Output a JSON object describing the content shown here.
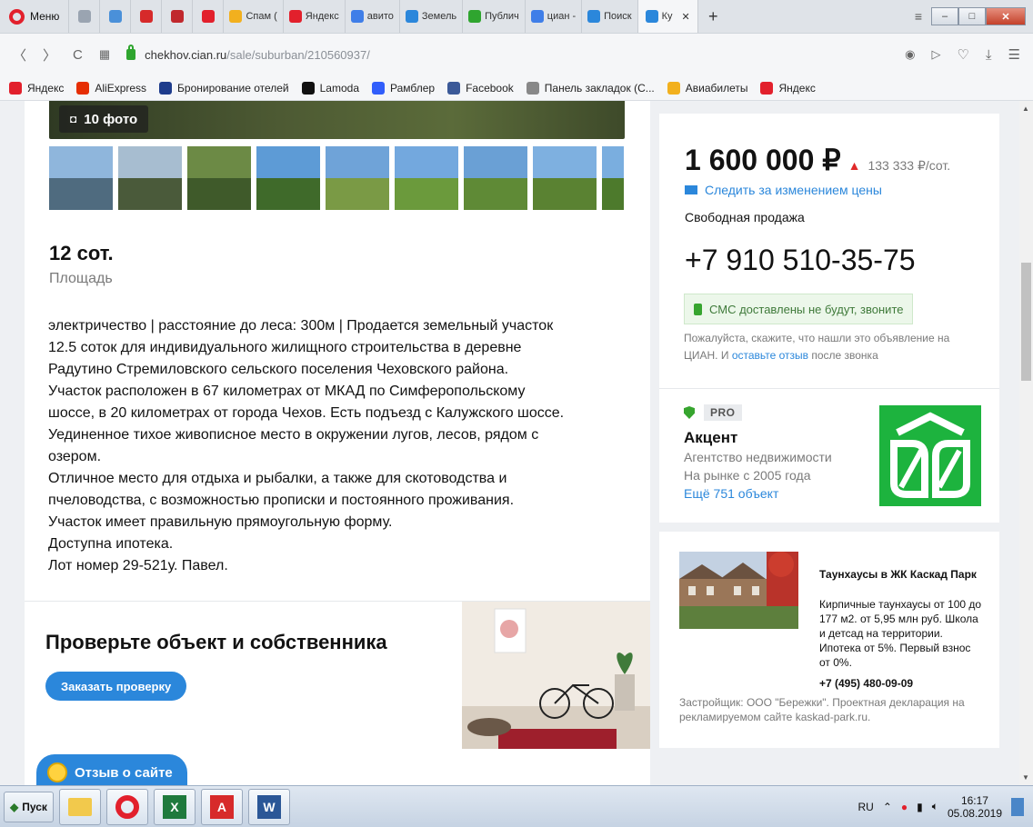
{
  "browser": {
    "menu_label": "Меню",
    "tabs": [
      {
        "label": "",
        "color": "#9aa4b1"
      },
      {
        "label": "",
        "color": "#4a90d9"
      },
      {
        "label": "",
        "color": "#d62a2a"
      },
      {
        "label": "",
        "color": "#c0282d"
      },
      {
        "label": "",
        "color": "#e2202c"
      },
      {
        "label": "Спам (",
        "color": "#f2b01e"
      },
      {
        "label": "Яндекс",
        "color": "#e2202c"
      },
      {
        "label": "авито",
        "color": "#3f7ee8"
      },
      {
        "label": "Земель",
        "color": "#2b87db"
      },
      {
        "label": "Публич",
        "color": "#2fa52f"
      },
      {
        "label": "циан -",
        "color": "#3f7ee8"
      },
      {
        "label": "Поиск",
        "color": "#2b87db"
      },
      {
        "label": "Ку",
        "color": "#2b87db"
      }
    ],
    "new_tab": "+",
    "url_domain": "chekhov.cian.ru",
    "url_path": "/sale/suburban/210560937/",
    "bookmarks": [
      {
        "label": "Яндекс",
        "color": "#e2202c"
      },
      {
        "label": "AliExpress",
        "color": "#e62e04"
      },
      {
        "label": "Бронирование отелей",
        "color": "#1e3c8c"
      },
      {
        "label": "Lamoda",
        "color": "#111111"
      },
      {
        "label": "Рамблер",
        "color": "#315efb"
      },
      {
        "label": "Facebook",
        "color": "#3b5998"
      },
      {
        "label": "Панель закладок (С...",
        "color": "#888888"
      },
      {
        "label": "Авиабилеты",
        "color": "#f2b01e"
      },
      {
        "label": "Яндекс",
        "color": "#e2202c"
      }
    ]
  },
  "listing": {
    "photo_count": "10 фото",
    "thumbnails": [
      {
        "sky": "#8fb6dc",
        "grass": "#4f6b7f"
      },
      {
        "sky": "#a7bdd0",
        "grass": "#4a5a3a"
      },
      {
        "sky": "#6c8a45",
        "grass": "#3f5a2a"
      },
      {
        "sky": "#5d9bd6",
        "grass": "#3f6a2a"
      },
      {
        "sky": "#6fa3d8",
        "grass": "#7a9a45"
      },
      {
        "sky": "#73a8de",
        "grass": "#6b9a3c"
      },
      {
        "sky": "#6aa0d5",
        "grass": "#5f8a36"
      },
      {
        "sky": "#7eb0e0",
        "grass": "#5a8232"
      },
      {
        "sky": "#7aaedf",
        "grass": "#4d7a2c"
      }
    ],
    "area_value": "12 сот.",
    "area_label": "Площадь",
    "description_lines": [
      "электричество | расстояние до леса: 300м | Продается земельный участок",
      "12.5 соток для индивидуального жилищного строительства в деревне",
      "Радутино Стремиловского сельского поселения Чеховского района.",
      "Участок расположен в 67 километрах от МКАД по Симферопольскому",
      "шоссе, в 20 километрах от города Чехов. Есть подъезд с Калужского шоссе.",
      "Уединенное тихое живописное место в окружении лугов, лесов, рядом с",
      "озером.",
      "Отличное место для отдыха и рыбалки, а также для скотоводства и",
      "пчеловодства, с возможностью прописки и постоянного проживания.",
      "Участок имеет правильную прямоугольную форму.",
      "Доступна ипотека.",
      "Лот номер 29-521у. Павел."
    ],
    "check_title": "Проверьте объект и собственника",
    "check_button": "Заказать проверку",
    "feedback_button": "Отзыв о сайте"
  },
  "price_card": {
    "price": "1 600 000 ₽",
    "price_per": "133 333 ₽/сот.",
    "follow_price": "Следить за изменением цены",
    "sale_type": "Свободная продажа",
    "phone": "+7 910 510-35-75",
    "sms_note": "СМС доставлены не будут, звоните",
    "note_before": "Пожалуйста, скажите, что нашли это объявление на ЦИАН. И ",
    "note_link": "оставьте отзыв",
    "note_after": " после звонка"
  },
  "agent": {
    "badge": "PRO",
    "name": "Акцент",
    "type": "Агентство недвижимости",
    "since": "На рынке с 2005 года",
    "more": "Ещё 751 объект"
  },
  "ad": {
    "title": "Таунхаусы в ЖК Каскад Парк",
    "text": "Кирпичные таунхаусы от 100 до 177 м2. от 5,95 млн руб. Школа и детсад на территории. Ипотека от 5%. Первый взнос от 0%.",
    "phone": "+7 (495) 480-09-09",
    "footer": "Застройщик: ООО \"Бережки\". Проектная декларация на рекламируемом сайте kaskad-park.ru."
  },
  "taskbar": {
    "start": "Пуск",
    "lang": "RU",
    "time": "16:17",
    "date": "05.08.2019"
  }
}
